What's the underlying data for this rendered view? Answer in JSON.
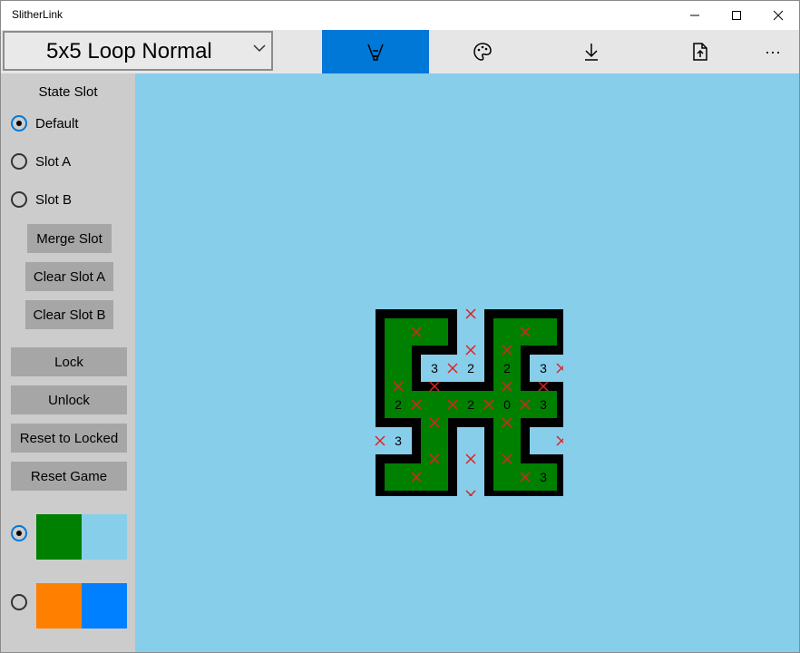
{
  "window": {
    "title": "SlitherLink"
  },
  "toolbar": {
    "puzzle_select": "5x5 Loop Normal",
    "buttons": [
      "brush-icon",
      "palette-icon",
      "download-icon",
      "export-icon",
      "more-icon"
    ],
    "more_label": "···",
    "accent": "#0078d7"
  },
  "sidebar": {
    "state_slot_title": "State Slot",
    "slots": [
      {
        "label": "Default",
        "checked": true
      },
      {
        "label": "Slot A",
        "checked": false
      },
      {
        "label": "Slot B",
        "checked": false
      }
    ],
    "merge_slot": "Merge Slot",
    "clear_slot_a": "Clear Slot A",
    "clear_slot_b": "Clear Slot B",
    "lock": "Lock",
    "unlock": "Unlock",
    "reset_to_locked": "Reset to Locked",
    "reset_game": "Reset Game",
    "themes": [
      {
        "checked": true,
        "inside": "#008000",
        "outside": "#87ceeb"
      },
      {
        "checked": false,
        "inside": "#ff8000",
        "outside": "#0080ff"
      }
    ]
  },
  "game": {
    "size": 5,
    "clues": [
      [
        "",
        "",
        "",
        "",
        ""
      ],
      [
        "",
        "3",
        "2",
        "2",
        "3"
      ],
      [
        "2",
        "",
        "2",
        "0",
        "3"
      ],
      [
        "3",
        "",
        "",
        "",
        ""
      ],
      [
        "",
        "",
        "",
        "",
        "3"
      ]
    ],
    "inside": [
      [
        1,
        1,
        0,
        1,
        1
      ],
      [
        1,
        0,
        0,
        1,
        0
      ],
      [
        1,
        1,
        1,
        1,
        1
      ],
      [
        0,
        1,
        0,
        1,
        0
      ],
      [
        1,
        1,
        0,
        1,
        1
      ]
    ],
    "crosses_h": [
      [
        0,
        0,
        1,
        0,
        0
      ],
      [
        0,
        0,
        1,
        1,
        0
      ],
      [
        1,
        1,
        0,
        1,
        1
      ],
      [
        0,
        1,
        0,
        1,
        0
      ],
      [
        0,
        1,
        1,
        1,
        0
      ],
      [
        0,
        0,
        1,
        0,
        0
      ]
    ],
    "crosses_v": [
      [
        0,
        1,
        0,
        0,
        1,
        0
      ],
      [
        0,
        0,
        1,
        0,
        0,
        1
      ],
      [
        0,
        1,
        1,
        1,
        1,
        0
      ],
      [
        1,
        0,
        0,
        0,
        0,
        1
      ],
      [
        0,
        1,
        0,
        0,
        1,
        0
      ]
    ],
    "colors": {
      "inside": "#008000",
      "outside": "#87ceeb",
      "line": "#000000",
      "cross": "#dd2222",
      "clue": "#000000"
    }
  }
}
